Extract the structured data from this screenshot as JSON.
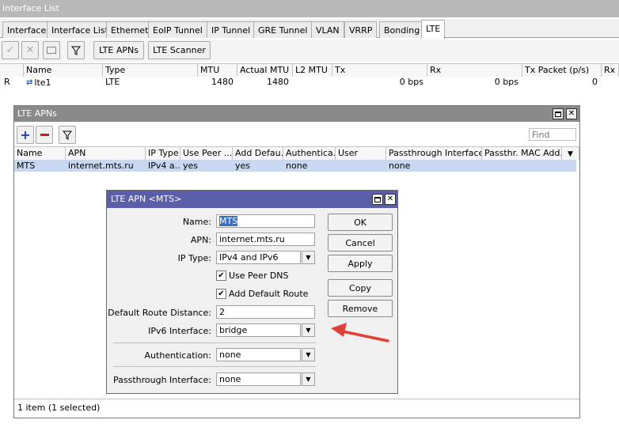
{
  "window": {
    "title": "Interface List"
  },
  "tabs": [
    "Interface",
    "Interface List",
    "Ethernet",
    "EoIP Tunnel",
    "IP Tunnel",
    "GRE Tunnel",
    "VLAN",
    "VRRP",
    "Bonding",
    "LTE"
  ],
  "toolbar": {
    "lte_apns": "LTE APNs",
    "lte_scanner": "LTE Scanner"
  },
  "iface_table": {
    "columns": [
      "Name",
      "Type",
      "MTU",
      "Actual MTU",
      "L2 MTU",
      "Tx",
      "Rx",
      "Tx Packet (p/s)",
      "Rx P"
    ],
    "row": {
      "flag": "R",
      "name": "lte1",
      "type": "LTE",
      "mtu": "1480",
      "actual_mtu": "1480",
      "l2_mtu": "",
      "tx": "0 bps",
      "rx": "0 bps",
      "tx_packet": "0"
    }
  },
  "apns_window": {
    "title": "LTE APNs",
    "find_placeholder": "Find",
    "columns": [
      "Name",
      "APN",
      "IP Type",
      "Use Peer ...",
      "Add Defau...",
      "Authentica...",
      "User",
      "Passthrough Interface",
      "Passthr. MAC Add..."
    ],
    "row": {
      "name": "MTS",
      "apn": "internet.mts.ru",
      "ip_type": "IPv4 a...",
      "use_peer": "yes",
      "add_default": "yes",
      "auth": "none",
      "user": "",
      "passthrough": "none",
      "mac": ""
    },
    "status": "1 item (1 selected)"
  },
  "apn_dialog": {
    "title": "LTE APN <MTS>",
    "labels": {
      "name": "Name:",
      "apn": "APN:",
      "ip_type": "IP Type:",
      "use_peer_dns": "Use Peer DNS",
      "add_default_route": "Add Default Route",
      "default_route_distance": "Default Route Distance:",
      "ipv6_interface": "IPv6 Interface:",
      "authentication": "Authentication:",
      "passthrough_interface": "Passthrough Interface:"
    },
    "values": {
      "name": "MTS",
      "apn": "internet.mts.ru",
      "ip_type": "IPv4 and IPv6",
      "use_peer_dns": true,
      "add_default_route": true,
      "default_route_distance": "2",
      "ipv6_interface": "bridge",
      "authentication": "none",
      "passthrough_interface": "none"
    },
    "buttons": {
      "ok": "OK",
      "cancel": "Cancel",
      "apply": "Apply",
      "copy": "Copy",
      "remove": "Remove"
    }
  },
  "colors": {
    "dialog_title": "#5b5ea8",
    "selection": "#c8d8f0",
    "arrow": "#e0403a"
  }
}
